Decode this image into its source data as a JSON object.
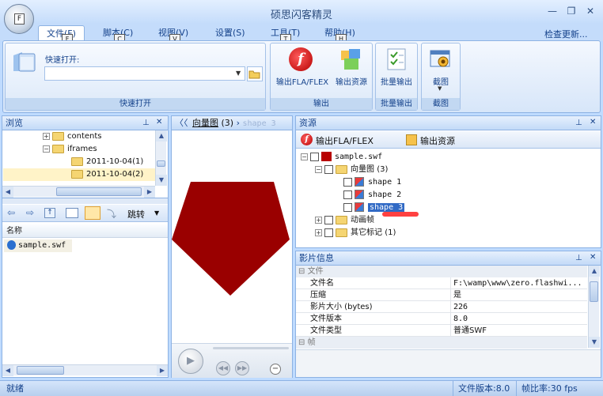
{
  "window": {
    "title": "硕思闪客精灵",
    "app_key": "F",
    "buttons": {
      "minimize": "—",
      "restore": "❐",
      "close": "✕"
    }
  },
  "tabs": [
    {
      "label": "文件(F)",
      "key": "F",
      "active": true
    },
    {
      "label": "脚本(C)",
      "key": "C"
    },
    {
      "label": "视图(V)",
      "key": "V"
    },
    {
      "label": "设置(S)",
      "key": ""
    },
    {
      "label": "工具(T)",
      "key": "T"
    },
    {
      "label": "帮助(H)",
      "key": "H"
    }
  ],
  "check_update": "检查更新...",
  "ribbon": {
    "quick_open": {
      "label": "快速打开:",
      "placeholder": "",
      "group": "快速打开"
    },
    "output": {
      "export_fla": "输出FLA/FLEX",
      "export_res": "输出资源",
      "group": "输出"
    },
    "batch": {
      "button": "批量输出",
      "group": "批量输出"
    },
    "capture": {
      "button": "截图",
      "group": "截图"
    }
  },
  "browse": {
    "title": "浏览",
    "tree": [
      {
        "label": "contents",
        "indent": 1,
        "expander": "+"
      },
      {
        "label": "iframes",
        "indent": 1,
        "expander": "−"
      },
      {
        "label": "2011-10-04(1)",
        "indent": 2
      },
      {
        "label": "2011-10-04(2)",
        "indent": 2
      }
    ],
    "jump": "跳转",
    "name_header": "名称",
    "files": [
      "sample.swf"
    ]
  },
  "preview": {
    "breadcrumb_main": "向量图",
    "breadcrumb_count": "(3)",
    "breadcrumb_current": "shape 3",
    "shape_color": "#9a0000"
  },
  "resources": {
    "title": "资源",
    "export_fla": "输出FLA/FLEX",
    "export_res": "输出资源",
    "root": "sample.swf",
    "vector_group": "向量图",
    "vector_count": "(3)",
    "shapes": [
      "shape 1",
      "shape 2",
      "shape 3"
    ],
    "anim_group": "动画帧",
    "other_group": "其它标记",
    "other_count": "(1)"
  },
  "movie_info": {
    "title": "影片信息",
    "category_file": "文件",
    "category_frame": "帧",
    "rows": [
      {
        "name": "文件名",
        "value": "F:\\wamp\\www\\zero.flashwi..."
      },
      {
        "name": "压缩",
        "value": "是"
      },
      {
        "name": "影片大小 (bytes)",
        "value": "226"
      },
      {
        "name": "文件版本",
        "value": "8.0"
      },
      {
        "name": "文件类型",
        "value": "普通SWF"
      }
    ]
  },
  "status": {
    "left": "就绪",
    "version": "文件版本:8.0",
    "fps": "帧比率:30 fps"
  }
}
